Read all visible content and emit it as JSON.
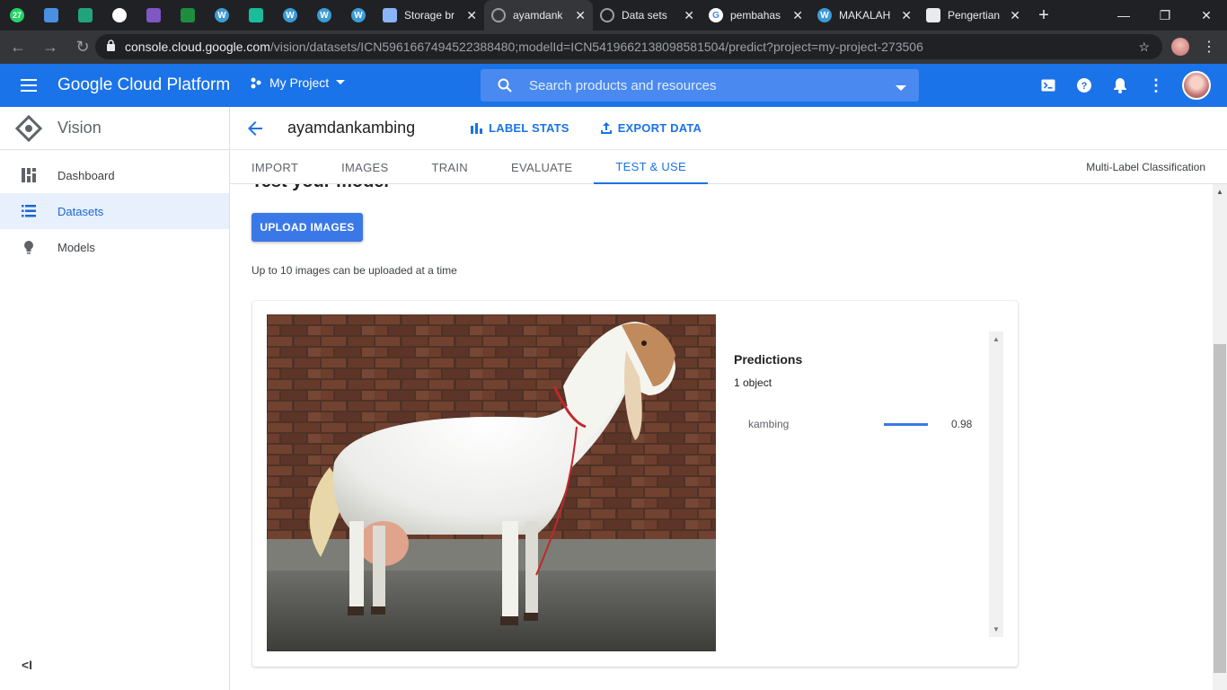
{
  "browser": {
    "pinned_tabs": [
      {
        "icon": "whatsapp-icon",
        "badge": "27",
        "color": "#25d366"
      },
      {
        "icon": "mail-icon",
        "color": "#4a90e2"
      },
      {
        "icon": "classroom-icon",
        "color": "#21a47c"
      },
      {
        "icon": "github-icon",
        "color": "#ffffff"
      },
      {
        "icon": "app-icon",
        "color": "#7e57c2"
      },
      {
        "icon": "classroom-icon",
        "color": "#1e8e3e"
      },
      {
        "icon": "wordpress-icon",
        "color": "#3d9bd6"
      },
      {
        "icon": "app-icon",
        "color": "#1abc9c"
      },
      {
        "icon": "wordpress-icon",
        "color": "#3d9bd6"
      },
      {
        "icon": "wordpress-icon",
        "color": "#3d9bd6"
      },
      {
        "icon": "wordpress-icon",
        "color": "#3d9bd6"
      }
    ],
    "tabs": [
      {
        "title": "Storage br",
        "icon": "storage-icon",
        "active": false
      },
      {
        "title": "ayamdank",
        "icon": "gcp-icon",
        "active": true
      },
      {
        "title": "Data sets",
        "icon": "gcp-icon",
        "active": false
      },
      {
        "title": "pembahas",
        "icon": "google-icon",
        "active": false
      },
      {
        "title": "MAKALAH",
        "icon": "wordpress-icon",
        "active": false
      },
      {
        "title": "Pengertian",
        "icon": "page-icon",
        "active": false
      }
    ],
    "url_host": "console.cloud.google.com",
    "url_path": "/vision/datasets/ICN5961667494522388480;modelId=ICN5419662138098581504/predict?project=my-project-273506"
  },
  "header": {
    "brand": "Google Cloud Platform",
    "project": "My Project",
    "search_placeholder": "Search products and resources"
  },
  "sidebar": {
    "product": "Vision",
    "items": [
      {
        "label": "Dashboard",
        "icon": "dashboard-icon",
        "active": false
      },
      {
        "label": "Datasets",
        "icon": "list-icon",
        "active": true
      },
      {
        "label": "Models",
        "icon": "lightbulb-icon",
        "active": false
      }
    ]
  },
  "dataset": {
    "name": "ayamdankambing",
    "label_stats": "LABEL STATS",
    "export_data": "EXPORT DATA"
  },
  "tabs": [
    {
      "label": "IMPORT",
      "active": false
    },
    {
      "label": "IMAGES",
      "active": false
    },
    {
      "label": "TRAIN",
      "active": false
    },
    {
      "label": "EVALUATE",
      "active": false
    },
    {
      "label": "TEST & USE",
      "active": true
    }
  ],
  "model_type": "Multi-Label Classification",
  "test": {
    "section_title": "Test your model",
    "upload_button": "UPLOAD IMAGES",
    "hint": "Up to 10 images can be uploaded at a time"
  },
  "predictions": {
    "title": "Predictions",
    "count": "1 object",
    "items": [
      {
        "label": "kambing",
        "score": "0.98",
        "score_value": 0.98
      }
    ]
  },
  "colors": {
    "primary": "#1a73e8",
    "button": "#3b78e7"
  }
}
